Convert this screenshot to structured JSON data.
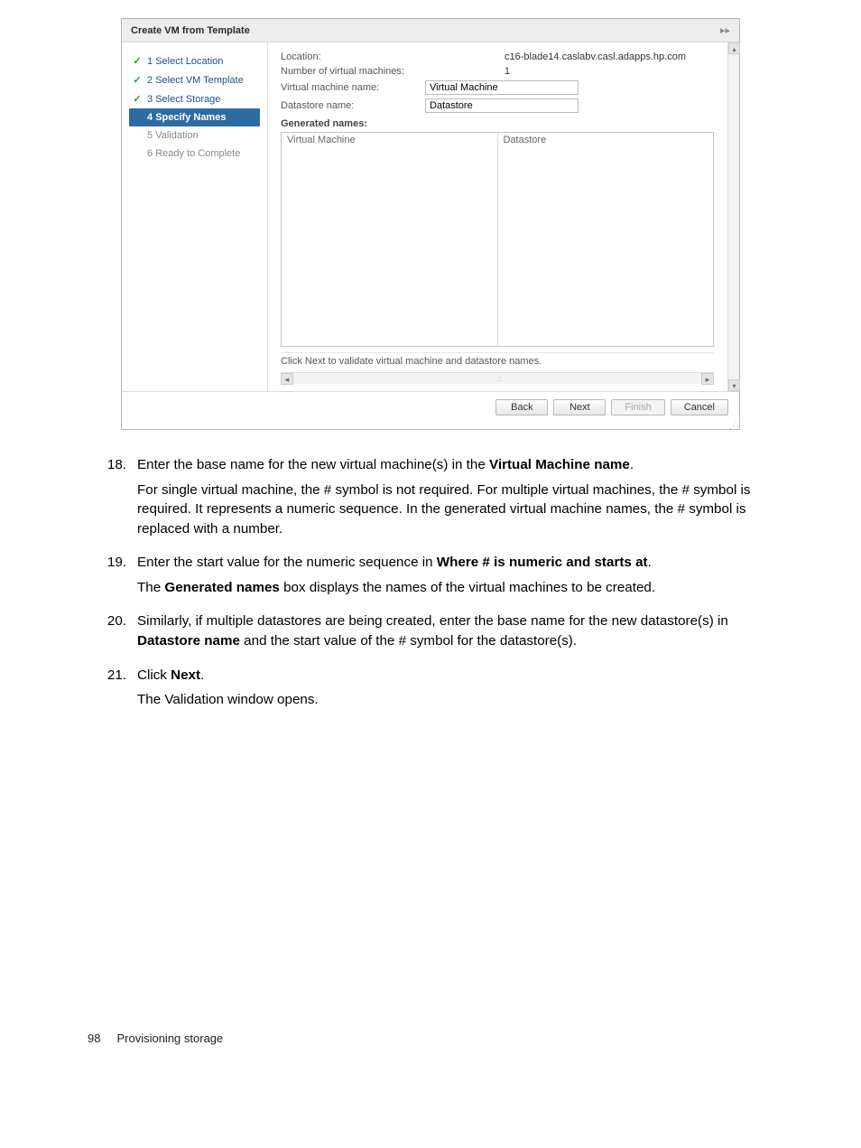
{
  "dialog": {
    "title": "Create VM from Template",
    "sidebar": {
      "steps": [
        {
          "num": "1",
          "label": "Select Location",
          "done": true
        },
        {
          "num": "2",
          "label": "Select VM Template",
          "done": true
        },
        {
          "num": "3",
          "label": "Select Storage",
          "done": true
        },
        {
          "num": "4",
          "label": "Specify Names",
          "current": true
        },
        {
          "num": "5",
          "label": "Validation",
          "future": true
        },
        {
          "num": "6",
          "label": "Ready to Complete",
          "future": true
        }
      ]
    },
    "form": {
      "location_label": "Location:",
      "location_value": "c16-blade14.caslabv.casl.adapps.hp.com",
      "numvm_label": "Number of virtual machines:",
      "numvm_value": "1",
      "vmname_label": "Virtual machine name:",
      "vmname_value": "Virtual Machine",
      "dsname_label": "Datastore name:",
      "dsname_value": "Datastore",
      "gen_label": "Generated names:",
      "gen_col1": "Virtual Machine",
      "gen_col2": "Datastore",
      "hint": "Click Next to validate virtual machine and datastore names."
    },
    "buttons": {
      "back": "Back",
      "next": "Next",
      "finish": "Finish",
      "cancel": "Cancel"
    }
  },
  "doc": {
    "items": [
      {
        "num": "18.",
        "lead": "Enter the base name for the new virtual machine(s) in the ",
        "bold1": "Virtual Machine name",
        "tail1": ".",
        "para2": "For single virtual machine, the # symbol is not required. For multiple virtual machines, the # symbol is required. It represents a numeric sequence. In the generated virtual machine names, the # symbol is replaced with a number."
      },
      {
        "num": "19.",
        "lead": "Enter the start value for the numeric sequence in ",
        "bold1": "Where # is numeric and starts at",
        "tail1": ".",
        "para2a": "The ",
        "para2bold": "Generated names",
        "para2b": " box displays the names of the virtual machines to be created."
      },
      {
        "num": "20.",
        "lead": "Similarly, if multiple datastores are being created, enter the base name for the new datastore(s) in ",
        "bold1": "Datastore name",
        "tail1": "  and the start value of the # symbol for the datastore(s)."
      },
      {
        "num": "21.",
        "lead": "Click ",
        "bold1": "Next",
        "tail1": ".",
        "para2": "The Validation window opens."
      }
    ]
  },
  "footer": {
    "page": "98",
    "section": "Provisioning storage"
  }
}
